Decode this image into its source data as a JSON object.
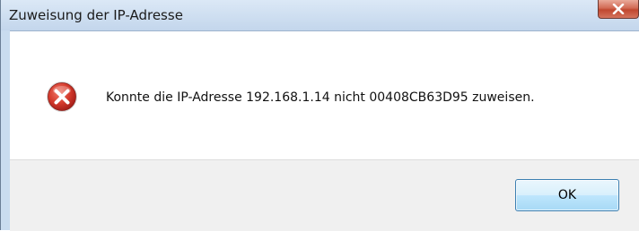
{
  "window": {
    "title": "Zuweisung der IP-Adresse",
    "close_icon": "close-icon"
  },
  "dialog": {
    "icon": "error-icon",
    "message": "Konnte die IP-Adresse 192.168.1.14 nicht 00408CB63D95 zuweisen.",
    "ok_label": "OK"
  },
  "colors": {
    "error_red": "#c8302b",
    "titlebar": "#c9dcef",
    "close_button": "#c0472f",
    "button_border": "#3c7fb1"
  }
}
